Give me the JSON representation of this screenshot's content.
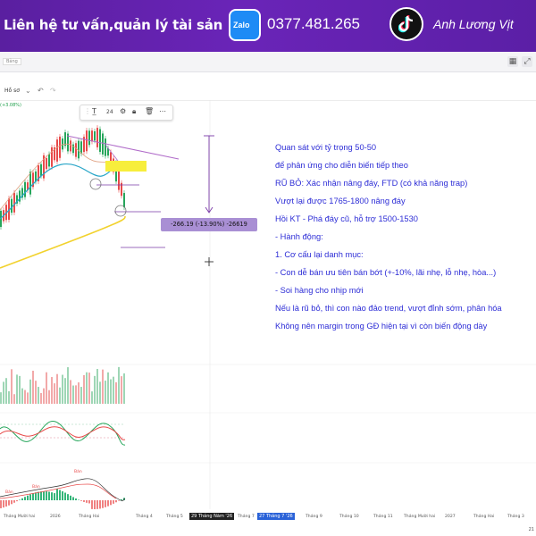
{
  "banner": {
    "title": "Liên hệ tư vấn,quản lý tài sản",
    "zalo_label": "Zalo",
    "phone": "0377.481.265",
    "name": "Anh Lương Vịt"
  },
  "window": {
    "tab_label": "Bảng",
    "profile_label": "Hồ sơ",
    "change_label": "(+3.08%)"
  },
  "drawbar": {
    "size": "24"
  },
  "notes": [
    "Quan sát với tỷ trọng 50-50",
    "để phản ứng cho diễn biến tiếp theo",
    "RŨ BỎ: Xác nhận nâng đáy, FTD (có khả năng trap)",
    "Vượt lại được 1765-1800 nâng đáy",
    "Hồi KT - Phá đáy cũ, hỗ trợ 1500-1530",
    "- Hành động:",
    "1. Cơ cấu lại danh mục:",
    "- Con dễ bán ưu tiên bán bớt (+-10%, lãi nhẹ, lỗ nhẹ, hòa...)",
    "- Soi hàng cho nhịp mới",
    "Nếu là rũ bỏ, thì con nào đảo trend, vượt đỉnh sớm, phân hóa",
    "Không nên margin trong GĐ hiện tại vì còn biến động dày"
  ],
  "measure_label": "-266.19 (-13.90%) -26619",
  "signal_labels": [
    "Bán",
    "Bán",
    "Bán"
  ],
  "time_axis": [
    "Tháng Mười hai",
    "2026",
    "Tháng Hai",
    "Tháng 4",
    "Tháng 5",
    "29 Tháng Năm '26",
    "Tháng 7",
    "27 Tháng 7 '26",
    "Tháng 9",
    "Tháng 10",
    "Tháng 11",
    "Tháng Mười hai",
    "2027",
    "Tháng Hai",
    "Tháng 3"
  ],
  "bottom_number": "21",
  "colors": {
    "banner": "#6a24b8",
    "price_up": "#26a65b",
    "price_down": "#e84a4a",
    "ma_long": "#f2d22e",
    "ma_mid": "#2aa6c8",
    "trendline": "#b06bc9",
    "annotation_text": "#2d2dd6",
    "highlight": "#f7ee3c"
  }
}
